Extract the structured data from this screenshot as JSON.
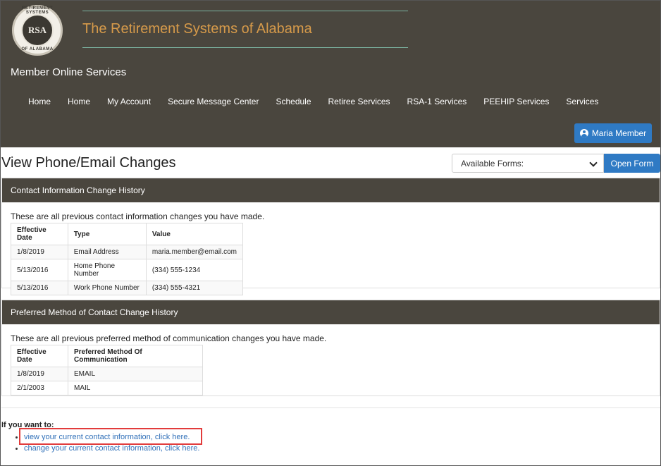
{
  "header": {
    "logo_text": "RSA",
    "logo_arc_top": "RETIREMENT SYSTEMS",
    "logo_arc_bottom": "OF ALABAMA",
    "site_title": "The Retirement Systems of Alabama",
    "app_name": "Member Online Services",
    "nav": [
      "Home",
      "Home",
      "My Account",
      "Secure Message Center",
      "Schedule",
      "Retiree Services",
      "RSA-1 Services",
      "PEEHIP Services",
      "Services"
    ],
    "user_button": "Maria Member"
  },
  "page": {
    "title": "View Phone/Email Changes",
    "forms_placeholder": "Available Forms:",
    "open_form": "Open Form"
  },
  "contact_panel": {
    "heading": "Contact Information Change History",
    "description": "These are all previous contact information changes you have made.",
    "columns": [
      "Effective Date",
      "Type",
      "Value"
    ],
    "rows": [
      [
        "1/8/2019",
        "Email Address",
        "maria.member@email.com"
      ],
      [
        "5/13/2016",
        "Home Phone Number",
        "(334) 555-1234"
      ],
      [
        "5/13/2016",
        "Work Phone Number",
        "(334) 555-4321"
      ]
    ]
  },
  "preferred_panel": {
    "heading": "Preferred Method of Contact Change History",
    "description": "These are all previous preferred method of communication changes you have made.",
    "columns": [
      "Effective Date",
      "Preferred Method Of Communication"
    ],
    "rows": [
      [
        "1/8/2019",
        "EMAIL"
      ],
      [
        "2/1/2003",
        "MAIL"
      ]
    ]
  },
  "footer": {
    "intro": "If you want to:",
    "links": [
      "view your current contact information, click here.",
      "change your current contact information, click here."
    ]
  },
  "colors": {
    "header_bg": "#4a463e",
    "title_orange": "#d69a4a",
    "accent_blue": "#2f7ac4",
    "highlight_red": "#e23c3c"
  }
}
